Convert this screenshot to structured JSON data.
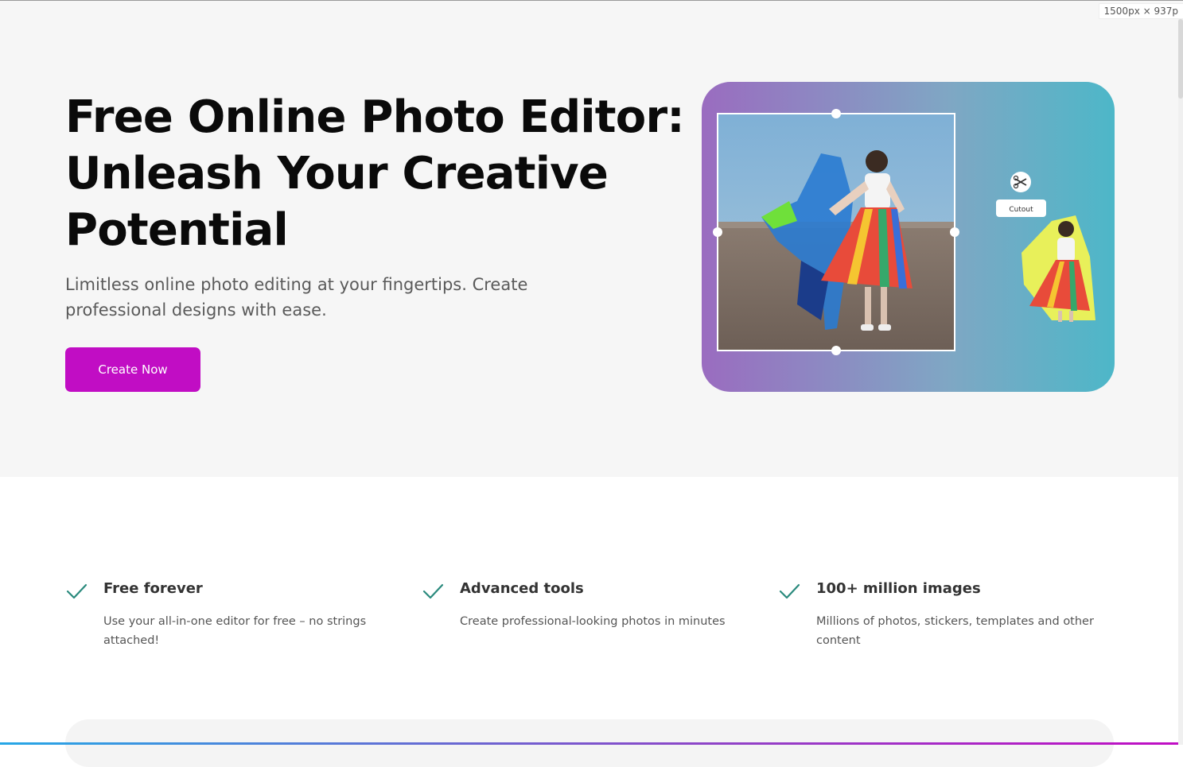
{
  "viewport_label": "1500px × 937p",
  "hero": {
    "title_lines": [
      "Free Online Photo Editor:",
      "Unleash Your Creative",
      "Potential"
    ],
    "subtitle": "Limitless online photo editing at your fingertips. Create professional designs with ease.",
    "cta_label": "Create Now",
    "cutout_label": "Cutout"
  },
  "features": [
    {
      "title": "Free forever",
      "description": "Use your all-in-one editor for free – no strings attached!"
    },
    {
      "title": "Advanced tools",
      "description": "Create professional-looking photos in minutes"
    },
    {
      "title": "100+ million images",
      "description": "Millions of photos, stickers, templates and other content"
    }
  ],
  "colors": {
    "accent": "#c10dc4",
    "check": "#2a8a7d",
    "hero_bg": "#f6f6f6",
    "title": "#0a0a0a"
  },
  "icons": {
    "feature_check": "check-icon",
    "cutout": "scissors-sparkle-icon"
  }
}
